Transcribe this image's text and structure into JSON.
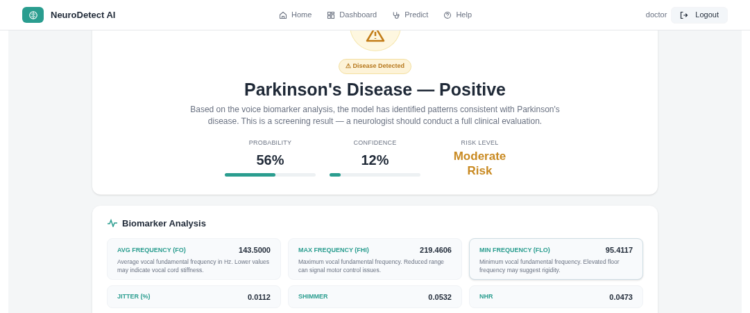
{
  "nav": {
    "brand": "NeuroDetect AI",
    "links": [
      {
        "label": "Home"
      },
      {
        "label": "Dashboard"
      },
      {
        "label": "Predict"
      },
      {
        "label": "Help"
      }
    ],
    "user": "doctor",
    "logout": "Logout"
  },
  "result": {
    "badge": "⚠ Disease Detected",
    "title": "Parkinson's Disease — Positive",
    "description": "Based on the voice biomarker analysis, the model has identified patterns consistent with Parkinson's disease. This is a screening result — a neurologist should conduct a full clinical evaluation.",
    "stats": [
      {
        "kind": "meter",
        "label": "PROBABILITY",
        "value": "56%",
        "level": 0.56
      },
      {
        "kind": "meter",
        "label": "CONFIDENCE",
        "value": "12%",
        "level": 0.12
      },
      {
        "kind": "text",
        "label": "RISK LEVEL",
        "value": "Moderate Risk"
      }
    ]
  },
  "biomarkers": {
    "title": "Biomarker Analysis",
    "items": [
      {
        "label": "AVG FREQUENCY (FO)",
        "value": "143.5000",
        "description": "Average vocal fundamental frequency in Hz. Lower values may indicate vocal cord stiffness.",
        "highlighted": false
      },
      {
        "label": "MAX FREQUENCY (FHI)",
        "value": "219.4606",
        "description": "Maximum vocal fundamental frequency. Reduced range can signal motor control issues.",
        "highlighted": false
      },
      {
        "label": "MIN FREQUENCY (FLO)",
        "value": "95.4117",
        "description": "Minimum vocal fundamental frequency. Elevated floor frequency may suggest rigidity.",
        "highlighted": true
      },
      {
        "label": "JITTER (%)",
        "value": "0.0112",
        "highlighted": false
      },
      {
        "label": "SHIMMER",
        "value": "0.0532",
        "highlighted": false
      },
      {
        "label": "NHR",
        "value": "0.0473",
        "highlighted": false
      }
    ]
  }
}
